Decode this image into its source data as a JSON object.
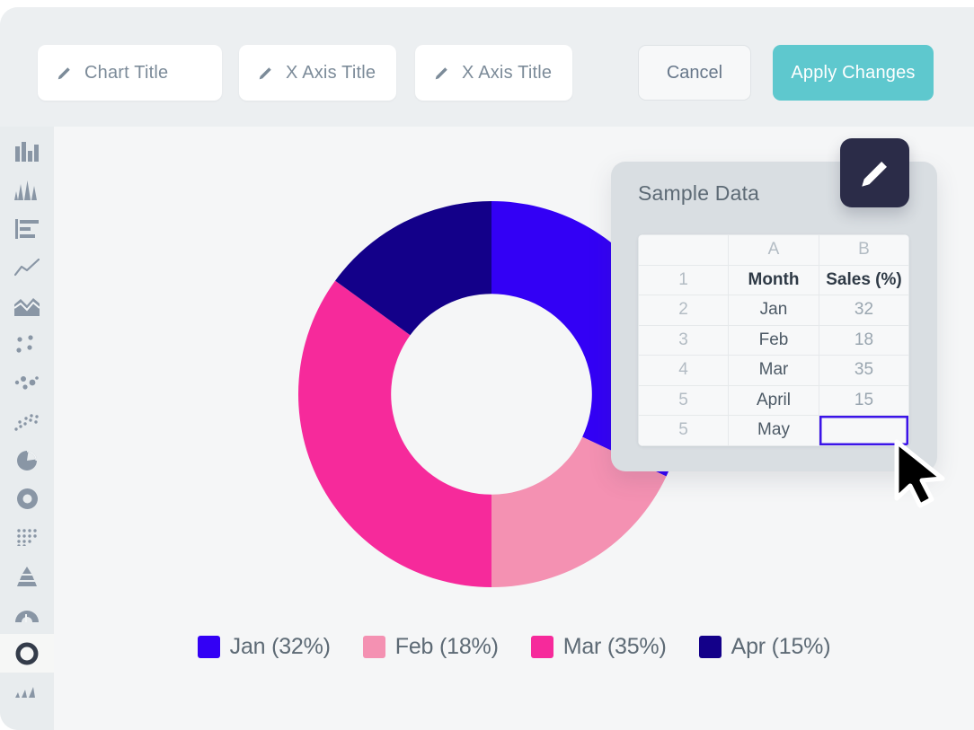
{
  "header": {
    "title_buttons": [
      {
        "label": "Chart Title",
        "icon": "pencil-icon"
      },
      {
        "label": "X Axis Title",
        "icon": "pencil-icon"
      },
      {
        "label": "X Axis Title",
        "icon": "pencil-icon"
      }
    ],
    "cancel_label": "Cancel",
    "apply_label": "Apply Changes",
    "apply_color": "#5ec8ce"
  },
  "sidebar": {
    "items": [
      {
        "name": "bar-chart-icon",
        "active": false
      },
      {
        "name": "peak-chart-icon",
        "active": false
      },
      {
        "name": "horizontal-bar-icon",
        "active": false
      },
      {
        "name": "line-chart-icon",
        "active": false
      },
      {
        "name": "area-chart-icon",
        "active": false
      },
      {
        "name": "dot-plot-icon",
        "active": false
      },
      {
        "name": "bubble-chart-icon",
        "active": false
      },
      {
        "name": "scatter-plot-icon",
        "active": false
      },
      {
        "name": "pie-chart-icon",
        "active": false
      },
      {
        "name": "donut-ring-icon",
        "active": false
      },
      {
        "name": "dot-matrix-icon",
        "active": false
      },
      {
        "name": "pyramid-chart-icon",
        "active": false
      },
      {
        "name": "gauge-chart-icon",
        "active": false
      },
      {
        "name": "donut-chart-icon",
        "active": true
      },
      {
        "name": "sparkline-icon",
        "active": false
      }
    ]
  },
  "data_panel": {
    "title": "Sample Data",
    "edit_button_icon": "pencil-icon",
    "columns": [
      "",
      "A",
      "B"
    ],
    "rows": [
      {
        "num": "1",
        "a": "Month",
        "b": "Sales (%)",
        "header": true,
        "selected": false
      },
      {
        "num": "2",
        "a": "Jan",
        "b": "32",
        "header": false,
        "selected": false
      },
      {
        "num": "3",
        "a": "Feb",
        "b": "18",
        "header": false,
        "selected": false
      },
      {
        "num": "4",
        "a": "Mar",
        "b": "35",
        "header": false,
        "selected": false
      },
      {
        "num": "5",
        "a": "April",
        "b": "15",
        "header": false,
        "selected": false
      },
      {
        "num": "5",
        "a": "May",
        "b": "",
        "header": false,
        "selected": true
      }
    ],
    "selected_cell_border": "#3b14e8"
  },
  "chart_data": {
    "type": "pie",
    "variant": "donut",
    "title": "",
    "categories": [
      "Jan",
      "Feb",
      "Mar",
      "Apr"
    ],
    "values": [
      32,
      18,
      35,
      15
    ],
    "unit": "%",
    "colors": [
      "#3300f5",
      "#f491b2",
      "#f62a9b",
      "#130089"
    ],
    "legend": [
      {
        "label": "Jan (32%)",
        "color": "#3300f5"
      },
      {
        "label": "Feb (18%)",
        "color": "#f491b2"
      },
      {
        "label": "Mar (35%)",
        "color": "#f62a9b"
      },
      {
        "label": "Apr (15%)",
        "color": "#130089"
      }
    ],
    "legend_position": "bottom",
    "start_angle": 0,
    "direction": "clockwise",
    "inner_radius_ratio": 0.52,
    "grid": false
  },
  "cursor": {
    "name": "mouse-pointer"
  }
}
